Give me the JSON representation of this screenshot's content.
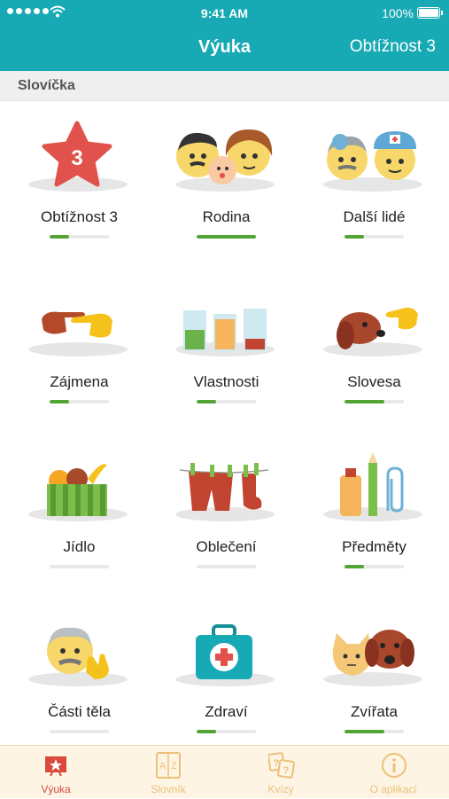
{
  "status_bar": {
    "time": "9:41 AM",
    "battery": "100%"
  },
  "navbar": {
    "title": "Výuka",
    "right_button": "Obtížnost 3"
  },
  "section": {
    "title": "Slovíčka"
  },
  "categories": [
    {
      "label": "Obtížnost 3",
      "badge": "3",
      "icon": "star-icon",
      "progress": 0.33
    },
    {
      "label": "Rodina",
      "icon": "family-icon",
      "progress": 1.0
    },
    {
      "label": "Další lidé",
      "icon": "people-icon",
      "progress": 0.33
    },
    {
      "label": "Zájmena",
      "icon": "pointing-hands-icon",
      "progress": 0.33
    },
    {
      "label": "Vlastnosti",
      "icon": "glasses-icon",
      "progress": 0.33
    },
    {
      "label": "Slovesa",
      "icon": "dog-hand-icon",
      "progress": 0.67
    },
    {
      "label": "Jídlo",
      "icon": "food-basket-icon",
      "progress": 0.0
    },
    {
      "label": "Oblečení",
      "icon": "clothesline-icon",
      "progress": 0.0
    },
    {
      "label": "Předměty",
      "icon": "objects-icon",
      "progress": 0.33
    },
    {
      "label": "Části těla",
      "icon": "face-touch-icon",
      "progress": 0.0
    },
    {
      "label": "Zdraví",
      "icon": "first-aid-kit-icon",
      "progress": 0.33
    },
    {
      "label": "Zvířata",
      "icon": "cat-dog-icon",
      "progress": 0.67
    }
  ],
  "tabs": [
    {
      "label": "Výuka",
      "icon": "board-icon",
      "active": true
    },
    {
      "label": "Slovník",
      "icon": "dictionary-icon",
      "active": false
    },
    {
      "label": "Kvízy",
      "icon": "quiz-icon",
      "active": false
    },
    {
      "label": "O aplikaci",
      "icon": "info-icon",
      "active": false
    }
  ],
  "colors": {
    "accent": "#17a9b4",
    "progress": "#52a535",
    "tab_active": "#d94a3d",
    "tab_inactive": "#ecc07a"
  }
}
